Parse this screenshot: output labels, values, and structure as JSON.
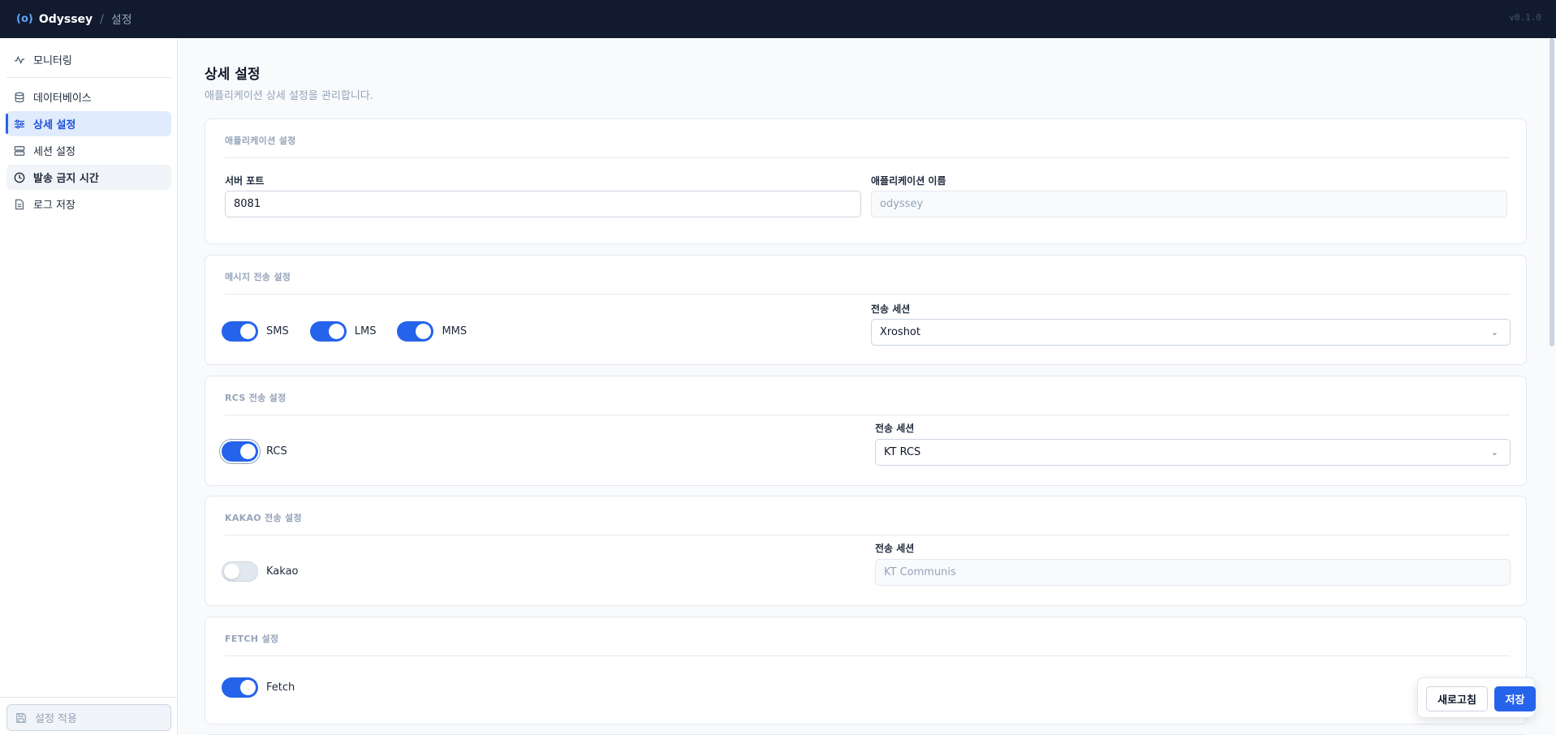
{
  "topbar": {
    "logo": "(o)",
    "brand": "Odyssey",
    "separator": "/",
    "crumb": "설정",
    "version": "v0.1.0"
  },
  "sidebar": {
    "items": [
      {
        "label": "모니터링",
        "icon": "activity-icon"
      },
      {
        "label": "데이터베이스",
        "icon": "database-icon"
      },
      {
        "label": "상세 설정",
        "icon": "sliders-icon",
        "active": true
      },
      {
        "label": "세션 설정",
        "icon": "server-icon"
      },
      {
        "label": "발송 금지 시간",
        "icon": "clock-icon"
      },
      {
        "label": "로그 저장",
        "icon": "file-icon"
      }
    ],
    "apply_label": "설정 적용"
  },
  "page": {
    "title": "상세 설정",
    "subtitle": "애플리케이션 상세 설정을 관리합니다."
  },
  "app_settings": {
    "title": "애플리케이션 설정",
    "port_label": "서버 포트",
    "port_value": "8081",
    "name_label": "애플리케이션 이름",
    "name_value": "odyssey"
  },
  "message_settings": {
    "title": "메시지 전송 설정",
    "toggles": [
      {
        "label": "SMS",
        "on": true
      },
      {
        "label": "LMS",
        "on": true
      },
      {
        "label": "MMS",
        "on": true
      }
    ],
    "session_label": "전송 세션",
    "session_value": "Xroshot"
  },
  "rcs_settings": {
    "title": "RCS 전송 설정",
    "toggle_label": "RCS",
    "on": true,
    "session_label": "전송 세션",
    "session_value": "KT RCS"
  },
  "kakao_settings": {
    "title": "KAKAO 전송 설정",
    "toggle_label": "Kakao",
    "on": false,
    "session_label": "전송 세션",
    "session_value": "KT Communis"
  },
  "fetch_settings": {
    "title": "FETCH 설정",
    "toggle_label": "Fetch",
    "on": true
  },
  "actions": {
    "refresh_label": "새로고침",
    "save_label": "저장"
  },
  "colors": {
    "accent": "#2563eb",
    "topbar": "#111a2e"
  }
}
